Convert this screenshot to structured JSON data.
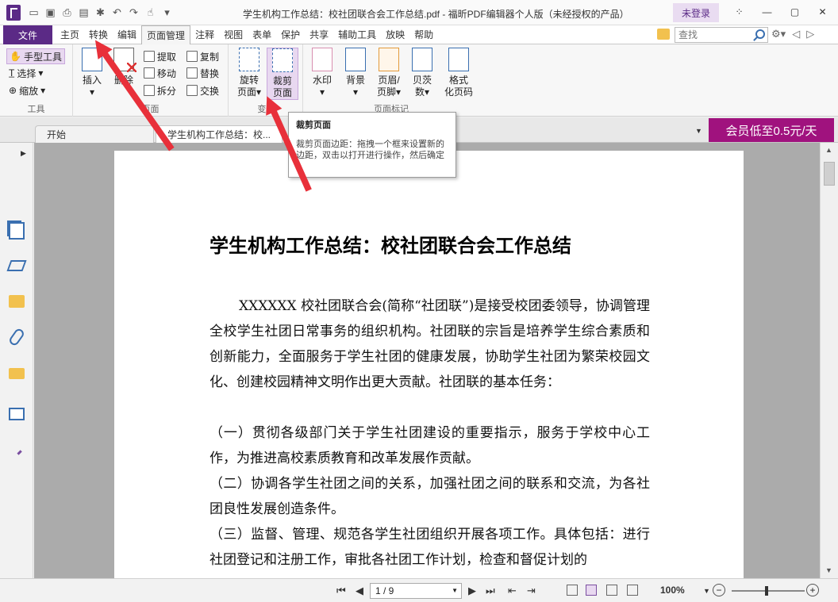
{
  "window": {
    "title": "学生机构工作总结：校社团联合会工作总结.pdf - 福昕PDF编辑器个人版（未经授权的产品）",
    "login": "未登录"
  },
  "ribbon_tabs": {
    "file": "文件",
    "tabs": [
      "主页",
      "转换",
      "编辑",
      "页面管理",
      "注释",
      "视图",
      "表单",
      "保护",
      "共享",
      "辅助工具",
      "放映",
      "帮助"
    ],
    "active": "页面管理"
  },
  "search": {
    "placeholder": "查找"
  },
  "ribbon": {
    "tools": {
      "hand": "手型工具",
      "select": "选择",
      "zoom": "缩放",
      "label": "工具"
    },
    "page": {
      "insert": "插入",
      "delete": "删除",
      "extract": "提取",
      "move": "移动",
      "split": "拆分",
      "copy": "复制",
      "replace": "替换",
      "swap": "交换",
      "label": "页面"
    },
    "transform": {
      "rotate": [
        "旋转",
        "页面"
      ],
      "crop": [
        "裁剪",
        "页面"
      ],
      "label": "变..."
    },
    "marks": {
      "watermark": "水印",
      "background": "背景",
      "header": [
        "页眉/",
        "页脚"
      ],
      "bates": [
        "贝茨",
        "数"
      ],
      "format": [
        "格式",
        "化页码"
      ],
      "label": "页面标记"
    }
  },
  "tooltip": {
    "title": "裁剪页面",
    "body": "裁剪页面边距：拖拽一个框来设置新的边距，双击以打开进行操作，然后确定"
  },
  "doc_tabs": [
    "开始",
    "学生机构工作总结：校..."
  ],
  "promo": "会员低至0.5元/天",
  "document": {
    "title": "学生机构工作总结：校社团联合会工作总结",
    "paragraphs": [
      "XXXXXX 校社团联合会(简称“社团联”)是接受校团委领导，协调管理全校学生社团日常事务的组织机构。社团联的宗旨是培养学生综合素质和创新能力，全面服务于学生社团的健康发展，协助学生社团为繁荣校园文化、创建校园精神文明作出更大贡献。社团联的基本任务：",
      "（一）贯彻各级部门关于学生社团建设的重要指示，服务于学校中心工作，为推进高校素质教育和改革发展作贡献。",
      "（二）协调各学生社团之间的关系，加强社团之间的联系和交流，为各社团良性发展创造条件。",
      "（三）监督、管理、规范各学生社团组织开展各项工作。具体包括：进行社团登记和注册工作，审批各社团工作计划，检查和督促计划的"
    ]
  },
  "statusbar": {
    "page": "1 / 9",
    "zoom": "100%"
  },
  "colors": {
    "brand": "#5b2a86",
    "promo": "#a0127e",
    "arrow": "#e8303a"
  }
}
